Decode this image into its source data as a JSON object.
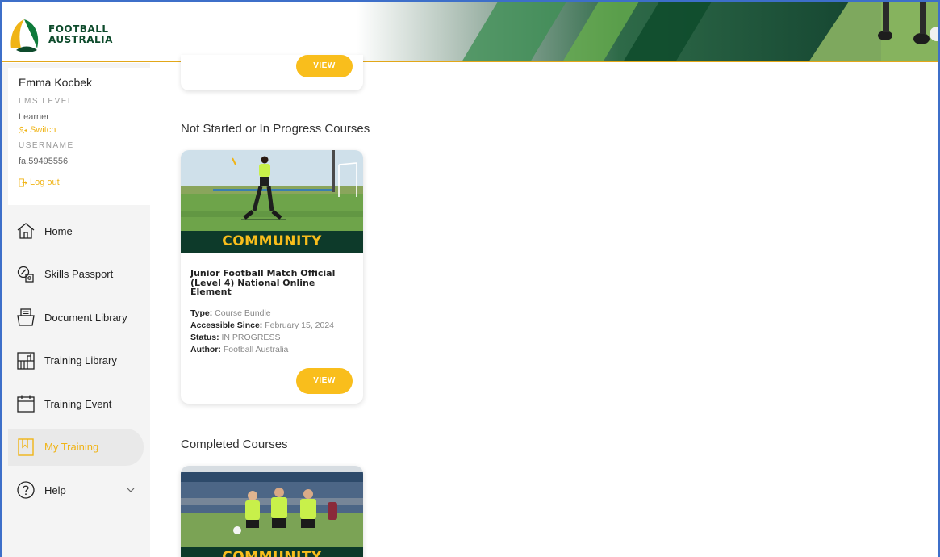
{
  "brand": {
    "line1": "FOOTBALL",
    "line2": "AUSTRALIA",
    "primary": "#0e4b2c",
    "accent": "#f9be1c"
  },
  "user": {
    "name": "Emma Kocbek",
    "lms_level_label": "LMS LEVEL",
    "lms_level_value": "Learner",
    "switch_label": "Switch",
    "username_label": "USERNAME",
    "username_value": "fa.59495556",
    "logout_label": "Log out"
  },
  "nav": {
    "items": [
      {
        "label": "Home",
        "icon": "home-icon"
      },
      {
        "label": "Skills Passport",
        "icon": "passport-icon"
      },
      {
        "label": "Document Library",
        "icon": "document-library-icon"
      },
      {
        "label": "Training Library",
        "icon": "training-library-icon"
      },
      {
        "label": "Training Event",
        "icon": "calendar-icon"
      },
      {
        "label": "My Training",
        "icon": "bookmark-icon",
        "active": true
      },
      {
        "label": "Help",
        "icon": "help-icon"
      }
    ]
  },
  "main": {
    "top_card": {
      "button_label": "VIEW"
    },
    "sections": [
      {
        "title": "Not Started or In Progress Courses",
        "card": {
          "banner": "COMMUNITY",
          "title": "Junior Football Match Official (Level 4) National Online Element",
          "type_label": "Type:",
          "type_value": "Course Bundle",
          "accessible_label": "Accessible Since:",
          "accessible_value": "February 15, 2024",
          "status_label": "Status:",
          "status_value": "IN PROGRESS",
          "author_label": "Author:",
          "author_value": "Football Australia",
          "button_label": "VIEW"
        }
      },
      {
        "title": "Completed Courses",
        "card": {
          "banner": "COMMUNITY"
        }
      }
    ]
  }
}
